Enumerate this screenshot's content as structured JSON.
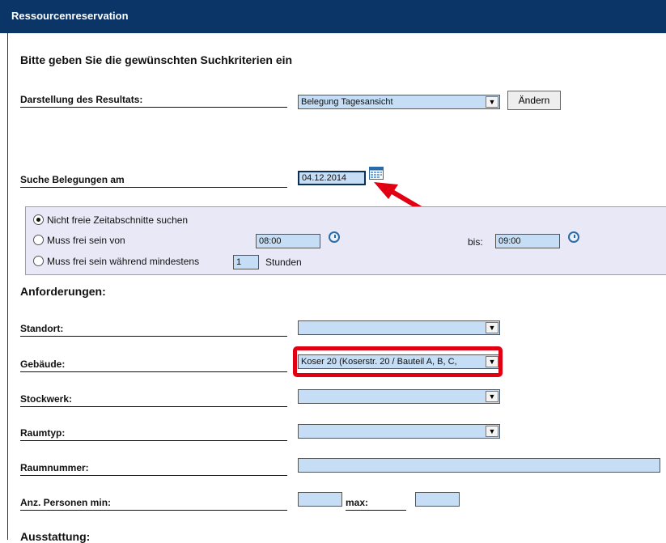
{
  "window": {
    "title": "Ressourcenreservation"
  },
  "heading": "Bitte geben Sie die gewünschten Suchkriterien ein",
  "display": {
    "label": "Darstellung des Resultats:",
    "selected": "Belegung Tagesansicht",
    "change_button": "Ändern"
  },
  "date_search": {
    "label": "Suche Belegungen am",
    "value": "04.12.2014"
  },
  "time_options": {
    "opt1": "Nicht freie Zeitabschnitte suchen",
    "opt2": "Muss frei sein von",
    "from_value": "08:00",
    "until_label": "bis:",
    "until_value": "09:00",
    "opt3": "Muss frei sein während mindestens",
    "hours_value": "1",
    "hours_unit": "Stunden",
    "selected_option": 1
  },
  "requirements": {
    "heading": "Anforderungen:",
    "standort_label": "Standort:",
    "standort_value": "",
    "gebaeude_label": "Gebäude:",
    "gebaeude_value": "Koser 20 (Koserstr. 20 / Bauteil A, B, C,",
    "stockwerk_label": "Stockwerk:",
    "stockwerk_value": "",
    "raumtyp_label": "Raumtyp:",
    "raumtyp_value": "",
    "raumnummer_label": "Raumnummer:",
    "raumnummer_value": "",
    "persons_label": "Anz. Personen min:",
    "persons_min_value": "",
    "persons_max_label": "max:",
    "persons_max_value": ""
  },
  "equipment": {
    "heading": "Ausstattung:"
  },
  "colors": {
    "title_bar": "#0b3566",
    "field_bg": "#c5def5",
    "option_panel_bg": "#e9e8f7",
    "highlight": "#e10012"
  }
}
